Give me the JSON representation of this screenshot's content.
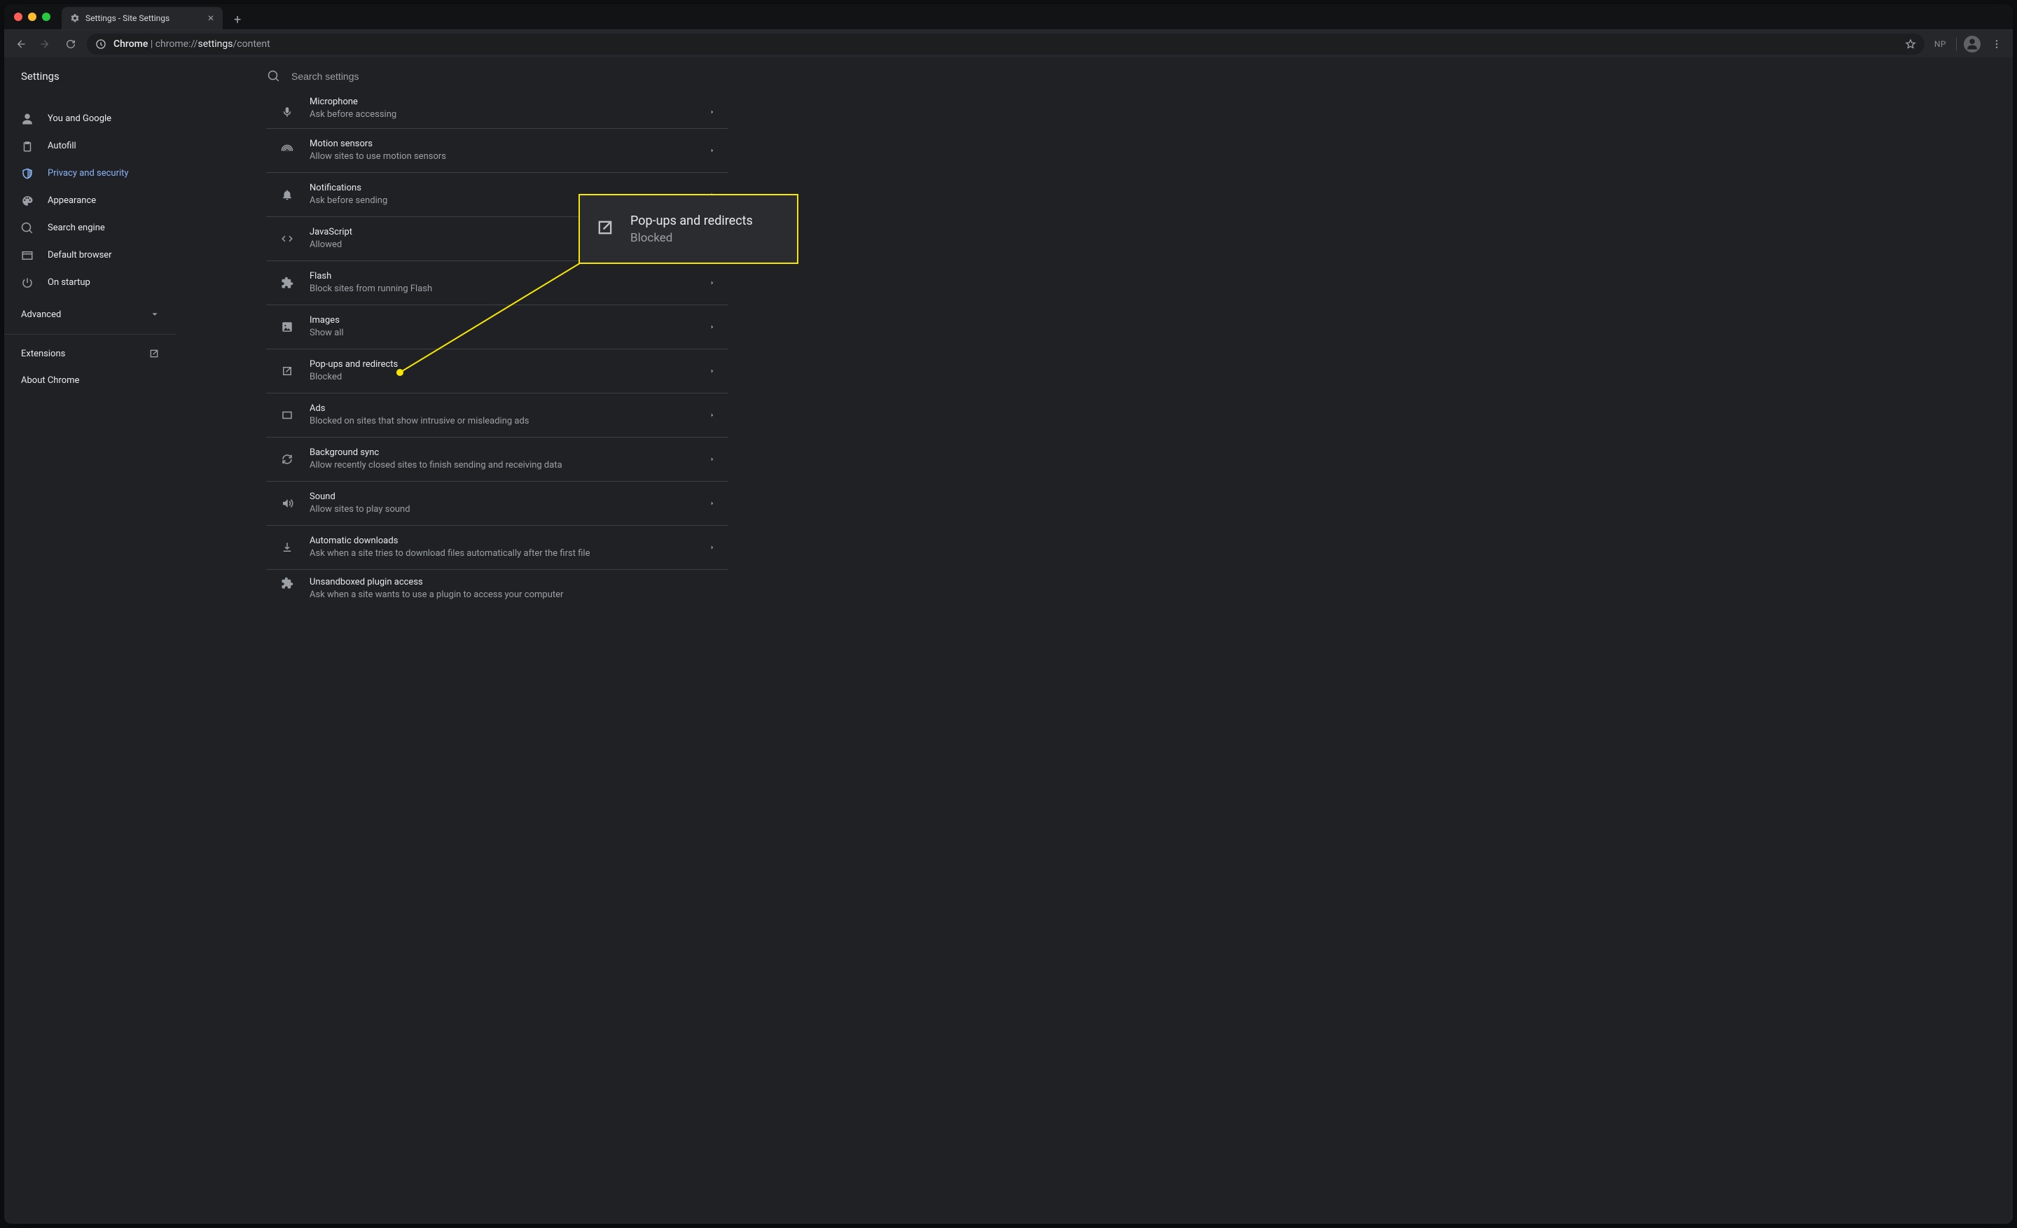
{
  "window": {
    "tab_title": "Settings - Site Settings",
    "url_host": "Chrome",
    "url_scheme": "chrome://",
    "url_path_strong": "settings",
    "url_path_rest": "/content",
    "profile_initials": "NP"
  },
  "page": {
    "title": "Settings",
    "search_placeholder": "Search settings",
    "advanced_label": "Advanced",
    "extensions_label": "Extensions",
    "about_label": "About Chrome"
  },
  "sidebar": [
    {
      "key": "you",
      "label": "You and Google"
    },
    {
      "key": "autofill",
      "label": "Autofill"
    },
    {
      "key": "privacy",
      "label": "Privacy and security",
      "active": true
    },
    {
      "key": "appearance",
      "label": "Appearance"
    },
    {
      "key": "search",
      "label": "Search engine"
    },
    {
      "key": "default",
      "label": "Default browser"
    },
    {
      "key": "startup",
      "label": "On startup"
    }
  ],
  "settings": [
    {
      "key": "mic",
      "label": "Microphone",
      "sub": "Ask before accessing"
    },
    {
      "key": "motion",
      "label": "Motion sensors",
      "sub": "Allow sites to use motion sensors"
    },
    {
      "key": "notif",
      "label": "Notifications",
      "sub": "Ask before sending"
    },
    {
      "key": "js",
      "label": "JavaScript",
      "sub": "Allowed"
    },
    {
      "key": "flash",
      "label": "Flash",
      "sub": "Block sites from running Flash"
    },
    {
      "key": "images",
      "label": "Images",
      "sub": "Show all"
    },
    {
      "key": "popups",
      "label": "Pop-ups and redirects",
      "sub": "Blocked"
    },
    {
      "key": "ads",
      "label": "Ads",
      "sub": "Blocked on sites that show intrusive or misleading ads"
    },
    {
      "key": "bgsync",
      "label": "Background sync",
      "sub": "Allow recently closed sites to finish sending and receiving data"
    },
    {
      "key": "sound",
      "label": "Sound",
      "sub": "Allow sites to play sound"
    },
    {
      "key": "autodl",
      "label": "Automatic downloads",
      "sub": "Ask when a site tries to download files automatically after the first file"
    },
    {
      "key": "plugin",
      "label": "Unsandboxed plugin access",
      "sub": "Ask when a site wants to use a plugin to access your computer"
    }
  ],
  "callout": {
    "title": "Pop-ups and redirects",
    "sub": "Blocked"
  },
  "colors": {
    "accent": "#8ab4f8",
    "highlight": "#f7e700"
  }
}
